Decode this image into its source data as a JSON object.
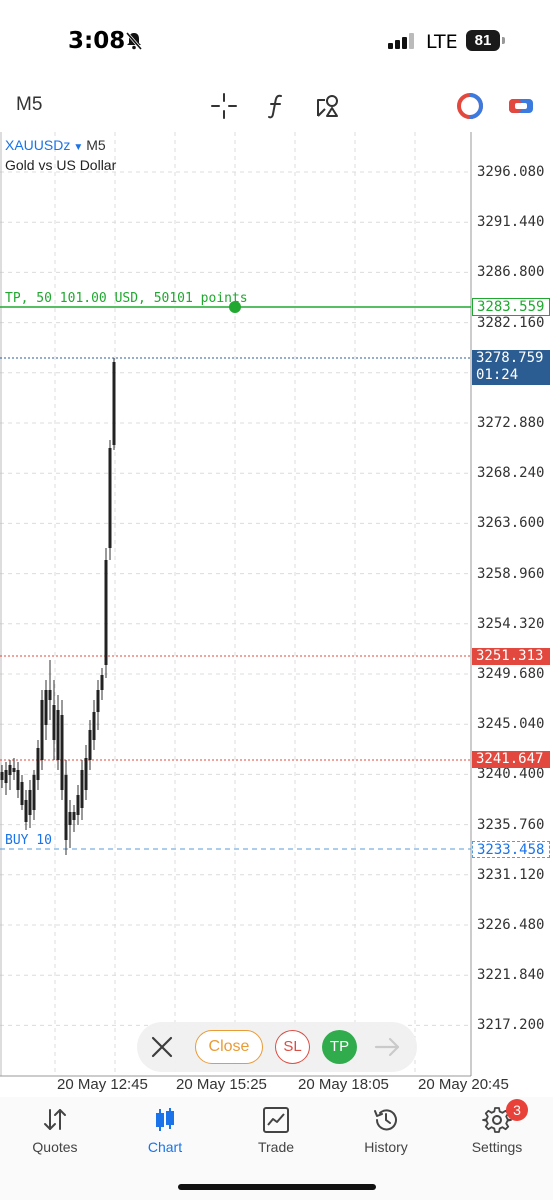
{
  "status_bar": {
    "time": "3:08",
    "carrier": "LTE",
    "battery": "81"
  },
  "toolbar": {
    "timeframe": "M5",
    "icons": [
      "crosshair-icon",
      "indicator-f-icon",
      "objects-icon",
      "account-icon",
      "trade-toggle-icon"
    ]
  },
  "chart": {
    "symbol": "XAUUSDz",
    "timeframe": "M5",
    "description": "Gold vs US Dollar",
    "tp_label": "TP, 50 101.00 USD, 50101 points",
    "buy_label": "BUY 10",
    "price_axis": [
      "3296.080",
      "3291.440",
      "3286.800",
      "3282.160",
      "3272.880",
      "3268.240",
      "3263.600",
      "3258.960",
      "3254.320",
      "3249.680",
      "3245.040",
      "3240.400",
      "3235.760",
      "3231.120",
      "3226.480",
      "3221.840",
      "3217.200"
    ],
    "tags": {
      "tp": "3283.559",
      "bid": "3278.759",
      "bid_timer": "01:24",
      "level1": "3251.313",
      "level2": "3241.647",
      "buy": "3233.458"
    },
    "time_axis": [
      "20 May 12:45",
      "20 May 15:25",
      "20 May 18:05",
      "20 May 20:45"
    ],
    "colors": {
      "tp_line": "#21a830",
      "bid_line": "#2b5d93",
      "red_line": "#e2483d",
      "buy_line": "#5b9bd8"
    }
  },
  "trade_panel": {
    "close_label": "Close",
    "sl_label": "SL",
    "tp_label": "TP"
  },
  "bottom_nav": {
    "items": [
      {
        "label": "Quotes",
        "icon": "quotes-arrows-icon"
      },
      {
        "label": "Chart",
        "icon": "candles-icon"
      },
      {
        "label": "Trade",
        "icon": "trade-chart-icon"
      },
      {
        "label": "History",
        "icon": "history-clock-icon"
      },
      {
        "label": "Settings",
        "icon": "gear-icon"
      }
    ],
    "settings_badge": "3"
  }
}
